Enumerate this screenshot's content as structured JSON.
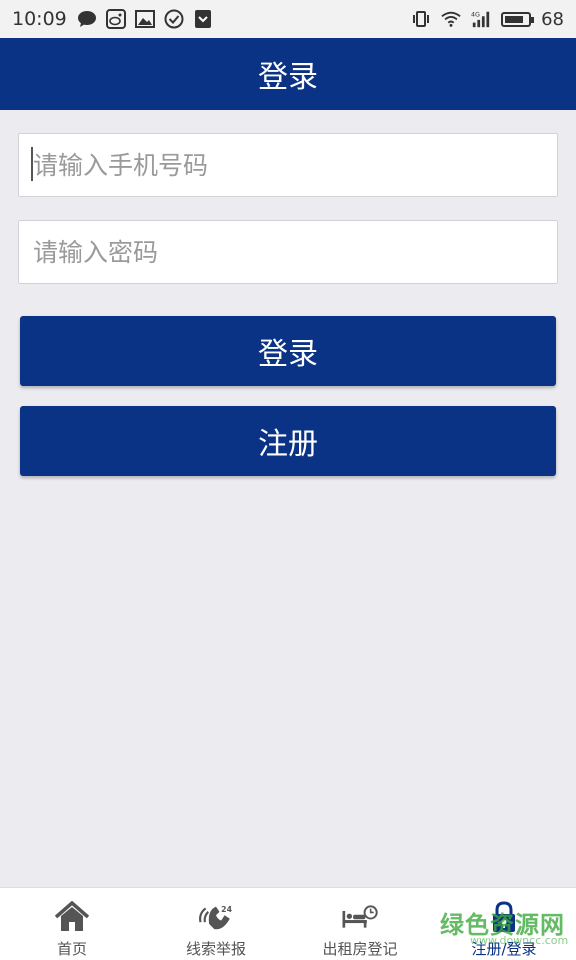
{
  "status_bar": {
    "time": "10:09",
    "battery_level": "68",
    "icons_left": [
      "chat-bubble-icon",
      "weibo-icon",
      "image-icon",
      "check-circle-icon",
      "shield-icon"
    ],
    "icons_right": [
      "vibrate-icon",
      "wifi-icon",
      "signal-4g-icon",
      "battery-icon"
    ]
  },
  "header": {
    "title": "登录"
  },
  "form": {
    "phone_placeholder": "请输入手机号码",
    "phone_value": "",
    "password_placeholder": "请输入密码",
    "password_value": "",
    "login_label": "登录",
    "register_label": "注册"
  },
  "bottom_nav": {
    "items": [
      {
        "label": "首页",
        "icon": "home-icon"
      },
      {
        "label": "线索举报",
        "icon": "phone-24h-icon"
      },
      {
        "label": "出租房登记",
        "icon": "bed-clock-icon"
      },
      {
        "label": "注册/登录",
        "icon": "lock-icon",
        "active": true
      }
    ]
  },
  "watermark": {
    "text": "绿色资源网",
    "url": "www.downcc.com"
  },
  "colors": {
    "primary": "#0A3285",
    "background": "#EBEBF0"
  }
}
